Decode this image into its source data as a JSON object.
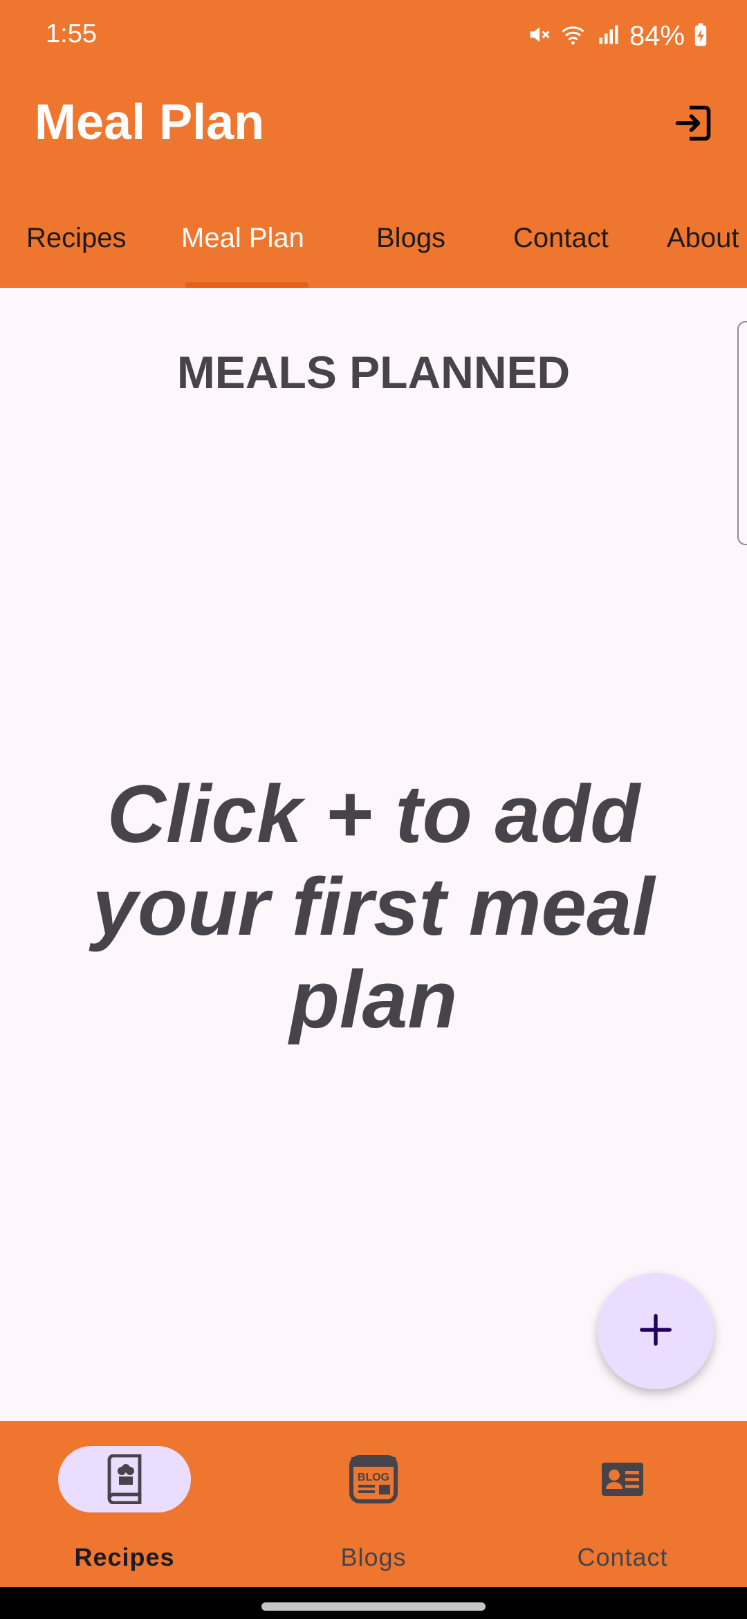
{
  "status_bar": {
    "time": "1:55",
    "battery": "84%",
    "icons": [
      "mute-icon",
      "wifi-icon",
      "signal-icon",
      "battery-charging-icon"
    ]
  },
  "app_bar": {
    "title": "Meal Plan",
    "action_icon": "logout-icon"
  },
  "tabs": [
    {
      "label": "Recipes",
      "active": false
    },
    {
      "label": "Meal Plan",
      "active": true
    },
    {
      "label": "Blogs",
      "active": false
    },
    {
      "label": "Contact",
      "active": false
    },
    {
      "label": "About",
      "active": false
    }
  ],
  "main": {
    "heading": "MEALS PLANNED",
    "empty_message": "Click + to add your first meal plan"
  },
  "fab": {
    "icon": "plus-icon"
  },
  "bottom_nav": [
    {
      "label": "Recipes",
      "icon": "recipe-book-icon",
      "active": true
    },
    {
      "label": "Blogs",
      "icon": "blog-icon",
      "active": false
    },
    {
      "label": "Contact",
      "icon": "contact-card-icon",
      "active": false
    }
  ],
  "colors": {
    "primary": "#EE762F",
    "background": "#FDF7FC",
    "text": "#46444A",
    "fab": "#EADDFF",
    "tab_indicator": "#E5601A"
  }
}
